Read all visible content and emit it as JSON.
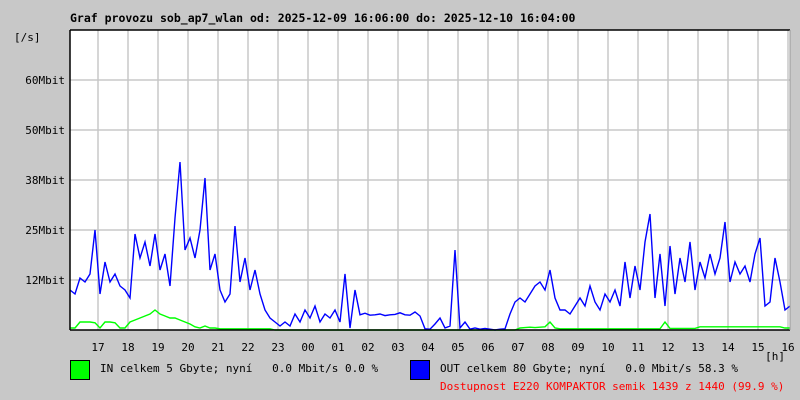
{
  "title": "Graf provozu sob_ap7_wlan od: 2025-12-09 16:06:00 do: 2025-12-10 16:04:00",
  "chart_data": {
    "type": "line",
    "title": "Graf provozu sob_ap7_wlan od: 2025-12-09 16:06:00 do: 2025-12-10 16:04:00",
    "ylabel": "[/s]",
    "xlabel": "[h]",
    "ylim": [
      0,
      75
    ],
    "y_unit": "Mbit",
    "y_ticks": [
      {
        "value": 12.5,
        "label": "12Mbit"
      },
      {
        "value": 25,
        "label": "25Mbit"
      },
      {
        "value": 37.5,
        "label": "38Mbit"
      },
      {
        "value": 50,
        "label": "50Mbit"
      },
      {
        "value": 62.5,
        "label": "60Mbit"
      }
    ],
    "x_ticks": [
      "17",
      "18",
      "19",
      "20",
      "21",
      "22",
      "23",
      "00",
      "01",
      "02",
      "03",
      "04",
      "05",
      "06",
      "07",
      "08",
      "09",
      "10",
      "11",
      "12",
      "13",
      "14",
      "15",
      "16"
    ],
    "x_start": "2025-12-09 16:06",
    "x_step_minutes": 10,
    "grid": true,
    "series": [
      {
        "name": "IN",
        "color": "#00ff00",
        "values": [
          0.5,
          0.5,
          2,
          2,
          2,
          1.8,
          0.5,
          2,
          2,
          1.8,
          0.5,
          0.5,
          2,
          2.5,
          3,
          3.5,
          4,
          5,
          4,
          3.5,
          3,
          3,
          2.5,
          2,
          1.5,
          0.8,
          0.5,
          1,
          0.5,
          0.5,
          0.3,
          0.3,
          0.3,
          0.3,
          0.3,
          0.3,
          0.3,
          0.3,
          0.3,
          0.3,
          0.3,
          0,
          0,
          0,
          0,
          0,
          0,
          0,
          0,
          0,
          0,
          0,
          0,
          0,
          0,
          0,
          0,
          0,
          0,
          0,
          0,
          0,
          0,
          0,
          0,
          0,
          0,
          0,
          0,
          0,
          0,
          0,
          0,
          0,
          0,
          0,
          0,
          0,
          0,
          0,
          0,
          0,
          0,
          0,
          0,
          0,
          0,
          0,
          0,
          0,
          0.5,
          0.6,
          0.7,
          0.6,
          0.7,
          0.8,
          2,
          0.5,
          0.3,
          0.3,
          0.3,
          0.3,
          0.3,
          0.3,
          0.3,
          0.3,
          0.3,
          0.3,
          0.3,
          0.3,
          0.3,
          0.3,
          0.3,
          0.3,
          0.3,
          0.3,
          0.3,
          0.3,
          0.3,
          2,
          0.4,
          0.4,
          0.4,
          0.4,
          0.4,
          0.4,
          0.8,
          0.8,
          0.8,
          0.8,
          0.8,
          0.8,
          0.8,
          0.8,
          0.8,
          0.8,
          0.8,
          0.8,
          0.8,
          0.8,
          0.8,
          0.8,
          0.8,
          0.5,
          0.5
        ]
      },
      {
        "name": "OUT",
        "color": "#0000ff",
        "values": [
          10,
          9,
          13,
          12,
          14,
          25,
          9,
          17,
          12,
          14,
          11,
          10,
          8,
          24,
          18,
          22,
          16,
          24,
          15,
          19,
          11,
          28,
          42,
          20,
          23,
          18,
          25,
          38,
          15,
          19,
          10,
          7,
          9,
          26,
          12,
          18,
          10,
          15,
          9,
          5,
          3,
          2,
          1,
          2,
          1,
          4,
          2,
          5,
          3,
          6,
          2,
          4,
          3,
          5,
          2,
          14,
          0.5,
          10,
          3.8,
          4.2,
          3.7,
          3.8,
          4.0,
          3.6,
          3.8,
          3.9,
          4.3,
          3.8,
          3.7,
          4.5,
          3.5,
          0.3,
          0.2,
          1.5,
          3,
          0.5,
          1,
          20,
          0.5,
          2,
          0.2,
          0.5,
          0.2,
          0.4,
          0.2,
          0,
          0.2,
          0.3,
          4,
          7,
          8,
          7,
          9,
          11,
          12,
          10,
          15,
          8,
          5,
          5,
          4,
          6,
          8,
          6,
          11,
          7,
          5,
          9,
          7,
          10,
          6,
          17,
          8,
          16,
          10,
          22,
          29,
          8,
          19,
          6,
          21,
          9,
          18,
          12,
          22,
          10,
          17,
          13,
          19,
          14,
          18,
          27,
          12,
          17,
          14,
          16,
          12,
          19,
          23,
          6,
          7,
          18,
          12,
          5,
          6
        ]
      }
    ]
  },
  "legend": {
    "in": {
      "color": "#00ff00",
      "text": "IN celkem 5 Gbyte; nyní   0.0 Mbit/s 0.0 %"
    },
    "out": {
      "color": "#0000ff",
      "text": "OUT celkem 80 Gbyte; nyní   0.0 Mbit/s 58.3 %"
    },
    "availability": "Dostupnost E220 KOMPAKTOR semik 1439 z 1440 (99.9 %)"
  }
}
